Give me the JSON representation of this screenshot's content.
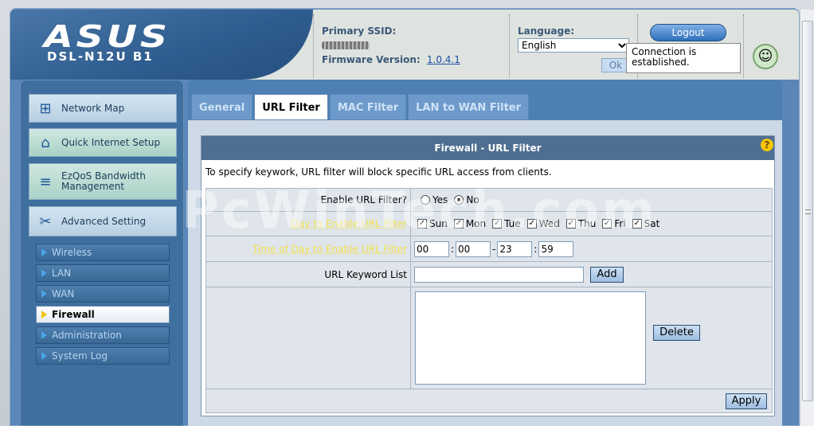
{
  "header": {
    "brand_logo": "ASUS",
    "model": "DSL-N12U B1",
    "ssid_label": "Primary SSID:",
    "firmware_label": "Firmware Version:",
    "firmware_version": "1.0.4.1",
    "language_label": "Language:",
    "language_value": "English",
    "ok_label": "Ok",
    "logout_label": "Logout",
    "tooltip": "Connection is established."
  },
  "sidebar": {
    "big_items": [
      {
        "label": "Network Map",
        "icon": "network-map-icon"
      },
      {
        "label": "Quick Internet Setup",
        "icon": "router-icon"
      },
      {
        "label": "EzQoS Bandwidth Management",
        "icon": "ezqos-icon"
      },
      {
        "label": "Advanced Setting",
        "icon": "tools-icon"
      }
    ],
    "sub_items": [
      "Wireless",
      "LAN",
      "WAN",
      "Firewall",
      "Administration",
      "System Log"
    ],
    "active": "Firewall"
  },
  "tabs": [
    "General",
    "URL Filter",
    "MAC Filter",
    "LAN to WAN Filter"
  ],
  "active_tab": "URL Filter",
  "panel": {
    "title": "Firewall - URL Filter",
    "description": "To specify keywork, URL filter will block specific URL access from clients.",
    "enable_label": "Enable URL Filter?",
    "yes_label": "Yes",
    "no_label": "No",
    "enabled": "No",
    "day_label": "Day to Enable URL Filter",
    "days": [
      "Sun",
      "Mon",
      "Tue",
      "Wed",
      "Thu",
      "Fri",
      "Sat"
    ],
    "time_label": "Time of Day to Enable URL Filter",
    "time_start_h": "00",
    "time_start_m": "00",
    "time_end_h": "23",
    "time_end_m": "59",
    "keyword_label": "URL Keyword List",
    "keyword_value": "",
    "add_label": "Add",
    "delete_label": "Delete",
    "apply_label": "Apply"
  },
  "watermark": "PcWinTech.com",
  "colors": {
    "accent": "#4e7fb3",
    "hint": "#f4e04a",
    "brand": "#2e5c8e"
  }
}
